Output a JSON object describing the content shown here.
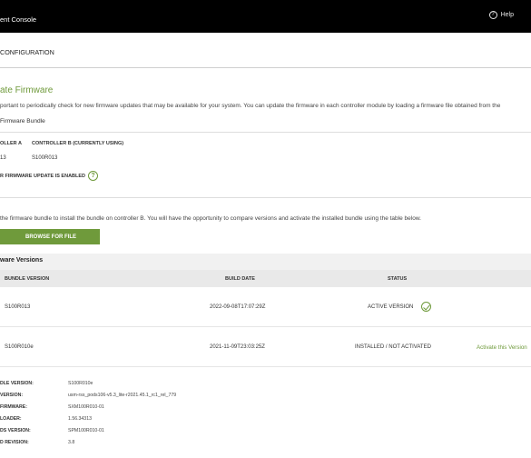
{
  "header": {
    "app_title": "ent Console",
    "help_label": "Help",
    "help_icon_glyph": "?"
  },
  "section_tab": "CONFIGURATION",
  "page": {
    "title": "ate Firmware",
    "description": "portant to periodically check for new firmware updates that may be available for your system. You can update the firmware in each controller module by loading a firmware file obtained from the",
    "bundle_subtitle": "Firmware Bundle"
  },
  "controllers": {
    "col_a": "OLLER A",
    "col_b": "CONTROLLER B (CURRENTLY USING)",
    "val_a": "13",
    "val_b": "S100R013"
  },
  "partner_update": {
    "label": "R FIRMWARE UPDATE IS ENABLED",
    "help_glyph": "?"
  },
  "upload": {
    "instructions": "the firmware bundle to install the bundle on controller B. You will have the opportunity to compare versions and activate the installed bundle using the table below.",
    "browse_label": "BROWSE FOR FILE"
  },
  "versions": {
    "title": "ware Versions",
    "columns": [
      "BUNDLE VERSION",
      "BUILD DATE",
      "STATUS"
    ],
    "rows": [
      {
        "bundle": "S100R013",
        "build_date": "2022-09-08T17:07:29Z",
        "status": "ACTIVE VERSION",
        "action": ""
      },
      {
        "bundle": "S100R010e",
        "build_date": "2021-11-09T23:03:25Z",
        "status": "INSTALLED / NOT ACTIVATED",
        "action": "Activate this Version"
      }
    ]
  },
  "details": [
    {
      "label": "DLE VERSION:",
      "value": "S100R010e"
    },
    {
      "label": "VERSION:",
      "value": "usm-rss_pods106-v5.3_lite-r2021.45.1_rc1_rel_779"
    },
    {
      "label": "FIRMWARE:",
      "value": "SXM100R010-01"
    },
    {
      "label": "LOADER:",
      "value": "1.56.34313"
    },
    {
      "label": "DS VERSION:",
      "value": "SPM100R010-01"
    },
    {
      "label": "D REVISION:",
      "value": "3.8"
    }
  ],
  "colors": {
    "accent": "#6f9a3b",
    "topbar": "#000000"
  }
}
